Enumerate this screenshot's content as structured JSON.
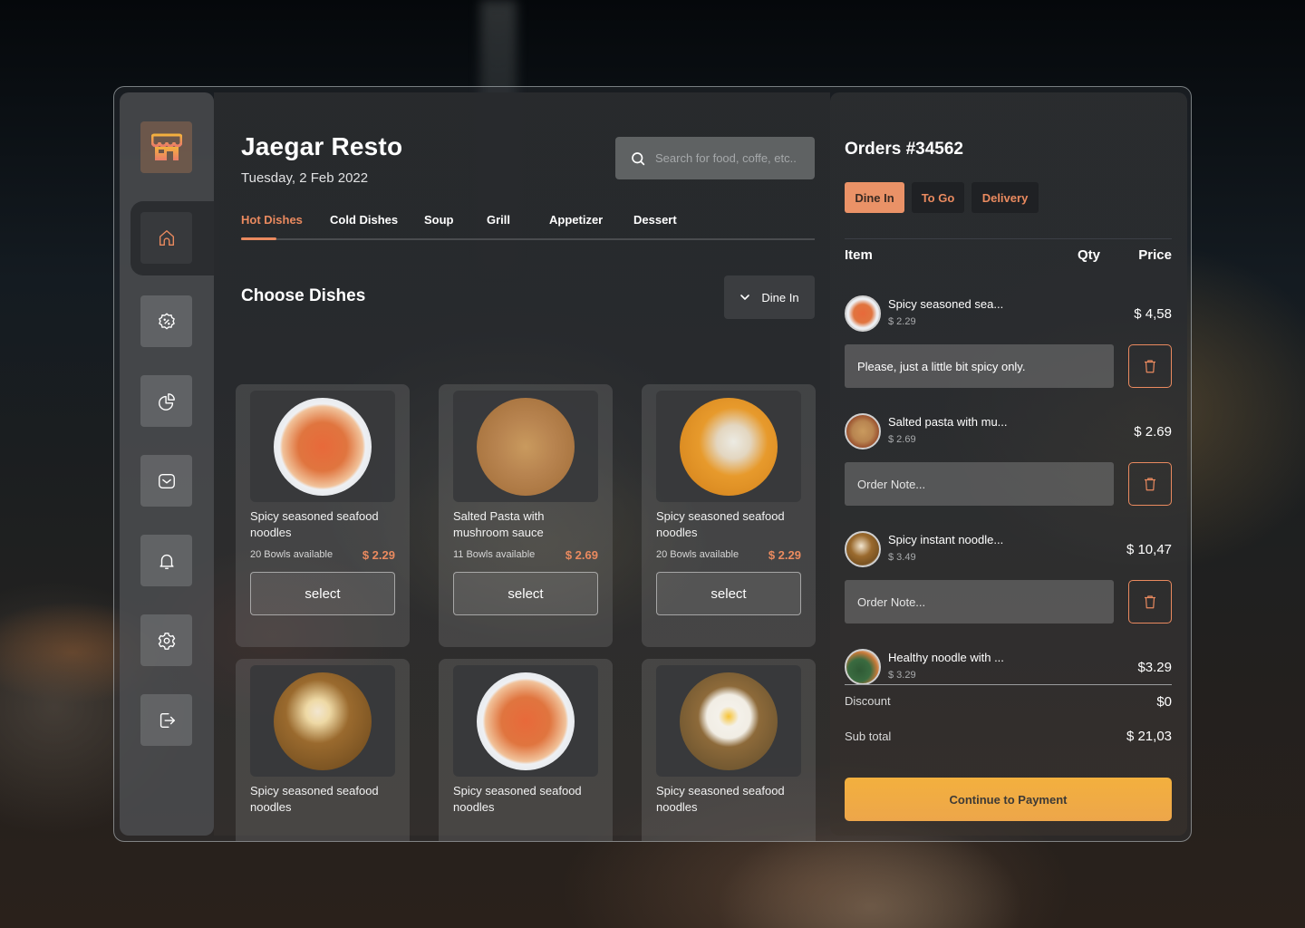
{
  "app": {
    "title": "Jaegar Resto",
    "date": "Tuesday, 2 Feb 2022",
    "accent_color": "#ea8a5f",
    "payment_button_color": "#f0ab43"
  },
  "sidebar": {
    "logo_icon": "store-icon",
    "items": [
      {
        "id": "home",
        "icon": "home-icon",
        "active": true
      },
      {
        "id": "discount",
        "icon": "discount-icon",
        "active": false
      },
      {
        "id": "dashboard",
        "icon": "pie-chart-icon",
        "active": false
      },
      {
        "id": "messages",
        "icon": "mail-icon",
        "active": false
      },
      {
        "id": "notifications",
        "icon": "bell-icon",
        "active": false
      },
      {
        "id": "settings",
        "icon": "gear-icon",
        "active": false
      },
      {
        "id": "logout",
        "icon": "logout-icon",
        "active": false
      }
    ]
  },
  "search": {
    "placeholder": "Search for food, coffe, etc..",
    "value": ""
  },
  "categories": {
    "active": "Hot Dishes",
    "tabs": [
      "Hot Dishes",
      "Cold Dishes",
      "Soup",
      "Grill",
      "Appetizer",
      "Dessert"
    ]
  },
  "menu": {
    "section_title": "Choose Dishes",
    "order_type_dropdown": "Dine In",
    "select_label": "select",
    "dishes": [
      {
        "name": "Spicy seasoned seafood noodles",
        "availability": "20 Bowls available",
        "price": "$ 2.29"
      },
      {
        "name": "Salted Pasta with mushroom sauce",
        "availability": "11 Bowls available",
        "price": "$ 2.69"
      },
      {
        "name": "Spicy seasoned seafood noodles",
        "availability": "20 Bowls available",
        "price": "$ 2.29"
      },
      {
        "name": "Spicy seasoned seafood noodles"
      },
      {
        "name": "Spicy seasoned seafood noodles"
      },
      {
        "name": "Spicy seasoned seafood noodles"
      }
    ]
  },
  "orders": {
    "title": "Orders #34562",
    "order_types": [
      {
        "label": "Dine In",
        "active": true
      },
      {
        "label": "To Go",
        "active": false
      },
      {
        "label": "Delivery",
        "active": false
      }
    ],
    "columns": {
      "item": "Item",
      "qty": "Qty",
      "price": "Price"
    },
    "note_placeholder": "Order Note...",
    "items": [
      {
        "name": "Spicy seasoned sea...",
        "unit_price": "$ 2.29",
        "total": "$ 4,58",
        "note": "Please, just a little bit spicy only."
      },
      {
        "name": "Salted pasta with mu...",
        "unit_price": "$ 2.69",
        "total": "$ 2.69",
        "note": ""
      },
      {
        "name": "Spicy instant noodle...",
        "unit_price": "$ 3.49",
        "total": "$ 10,47",
        "note": ""
      },
      {
        "name": "Healthy noodle with ...",
        "unit_price": "$ 3.29",
        "total": "$3.29",
        "note": ""
      }
    ],
    "summary": {
      "discount_label": "Discount",
      "discount_value": "$0",
      "subtotal_label": "Sub total",
      "subtotal_value": "$ 21,03"
    },
    "continue_label": "Continue to Payment"
  }
}
